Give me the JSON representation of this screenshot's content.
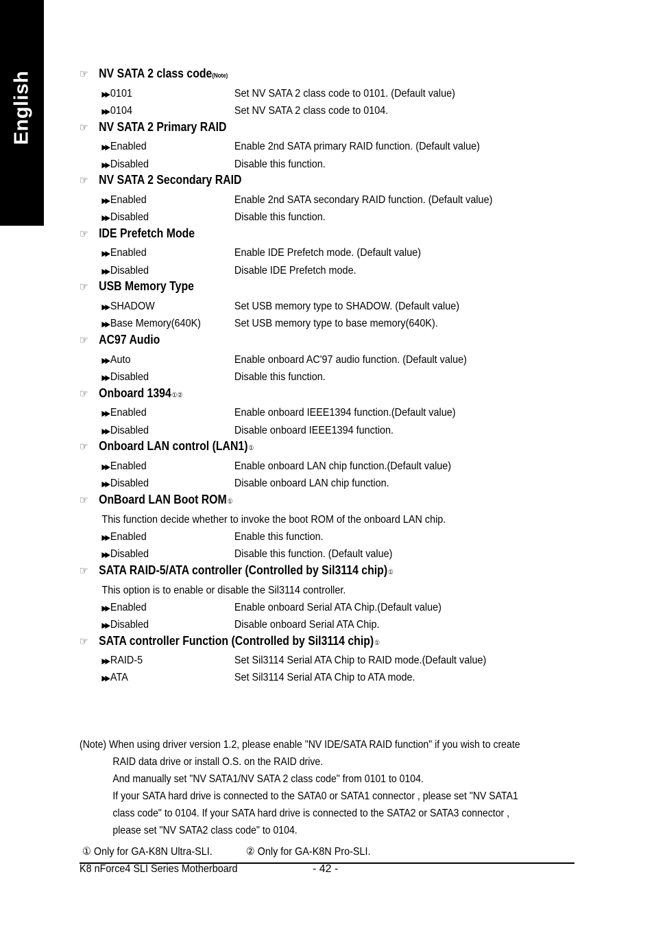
{
  "side_tab": {
    "label": "English"
  },
  "sections": [
    {
      "title": "NV SATA 2 class code",
      "superscript": "(Note)",
      "marks": "",
      "options": [
        {
          "name": "0101",
          "desc": "Set NV SATA 2 class code to 0101. (Default value)"
        },
        {
          "name": "0104",
          "desc": "Set NV SATA 2 class code to 0104."
        }
      ]
    },
    {
      "title": "NV SATA 2 Primary RAID",
      "options": [
        {
          "name": "Enabled",
          "desc": "Enable 2nd SATA primary RAID function. (Default value)"
        },
        {
          "name": "Disabled",
          "desc": "Disable this function."
        }
      ]
    },
    {
      "title": "NV SATA 2 Secondary RAID",
      "options": [
        {
          "name": "Enabled",
          "desc": "Enable 2nd SATA secondary RAID function. (Default value)"
        },
        {
          "name": "Disabled",
          "desc": "Disable this function."
        }
      ]
    },
    {
      "title": "IDE Prefetch Mode",
      "options": [
        {
          "name": "Enabled",
          "desc": "Enable IDE Prefetch mode. (Default value)"
        },
        {
          "name": "Disabled",
          "desc": "Disable IDE Prefetch mode."
        }
      ]
    },
    {
      "title": "USB Memory Type",
      "options": [
        {
          "name": "SHADOW",
          "desc": "Set USB memory type to SHADOW. (Default value)"
        },
        {
          "name": "Base Memory(640K)",
          "desc": "Set USB memory type to base memory(640K)."
        }
      ]
    },
    {
      "title": "AC97 Audio",
      "options": [
        {
          "name": "Auto",
          "desc": "Enable onboard AC'97 audio function. (Default value)"
        },
        {
          "name": "Disabled",
          "desc": "Disable this function."
        }
      ]
    },
    {
      "title": "Onboard 1394",
      "marks": "①②",
      "options": [
        {
          "name": "Enabled",
          "desc": "Enable onboard IEEE1394 function.(Default value)"
        },
        {
          "name": "Disabled",
          "desc": "Disable onboard IEEE1394 function."
        }
      ]
    },
    {
      "title": "Onboard  LAN  control (LAN1)",
      "marks": "①",
      "options": [
        {
          "name": "Enabled",
          "desc": "Enable onboard LAN chip function.(Default value)"
        },
        {
          "name": "Disabled",
          "desc": "Disable onboard LAN chip function."
        }
      ]
    },
    {
      "title": "OnBoard LAN Boot ROM",
      "marks": "①",
      "description": "This function decide whether to invoke the boot ROM of the onboard LAN chip.",
      "options": [
        {
          "name": "Enabled",
          "desc": "Enable this function."
        },
        {
          "name": "Disabled",
          "desc": "Disable this function. (Default value)"
        }
      ]
    },
    {
      "title": "SATA RAID-5/ATA controller (Controlled by Sil3114 chip)",
      "marks": "①",
      "description": "This option is to enable or disable the Sil3114 controller.",
      "options": [
        {
          "name": "Enabled",
          "desc": "Enable onboard Serial ATA Chip.(Default value)"
        },
        {
          "name": "Disabled",
          "desc": "Disable onboard Serial ATA Chip."
        }
      ]
    },
    {
      "title": "SATA controller Function (Controlled by Sil3114 chip)",
      "marks": "①",
      "options": [
        {
          "name": "RAID-5",
          "desc": "Set Sil3114 Serial ATA Chip to RAID mode.(Default value)"
        },
        {
          "name": "ATA",
          "desc": "Set Sil3114 Serial ATA Chip to ATA mode."
        }
      ]
    }
  ],
  "note": {
    "lines": [
      "(Note) When using driver version 1.2, please enable \"NV IDE/SATA RAID function\" if you wish to create",
      "RAID data drive or install O.S. on the RAID drive.",
      "And manually set \"NV SATA1/NV SATA 2 class code\" from 0101 to 0104.",
      "If your SATA hard drive is connected  to the SATA0 or SATA1 connector , please set  \"NV SATA1",
      "class code\" to 0104. If your SATA hard drive is connected  to the SATA2 or SATA3 connector ,",
      "please set \"NV SATA2 class code\" to 0104."
    ]
  },
  "footnotes": {
    "fn1": "① Only for GA-K8N Ultra-SLI.",
    "fn2": "② Only for GA-K8N Pro-SLI."
  },
  "footer": {
    "model": "K8 nForce4 SLI Series Motherboard",
    "page": "- 42 -"
  }
}
